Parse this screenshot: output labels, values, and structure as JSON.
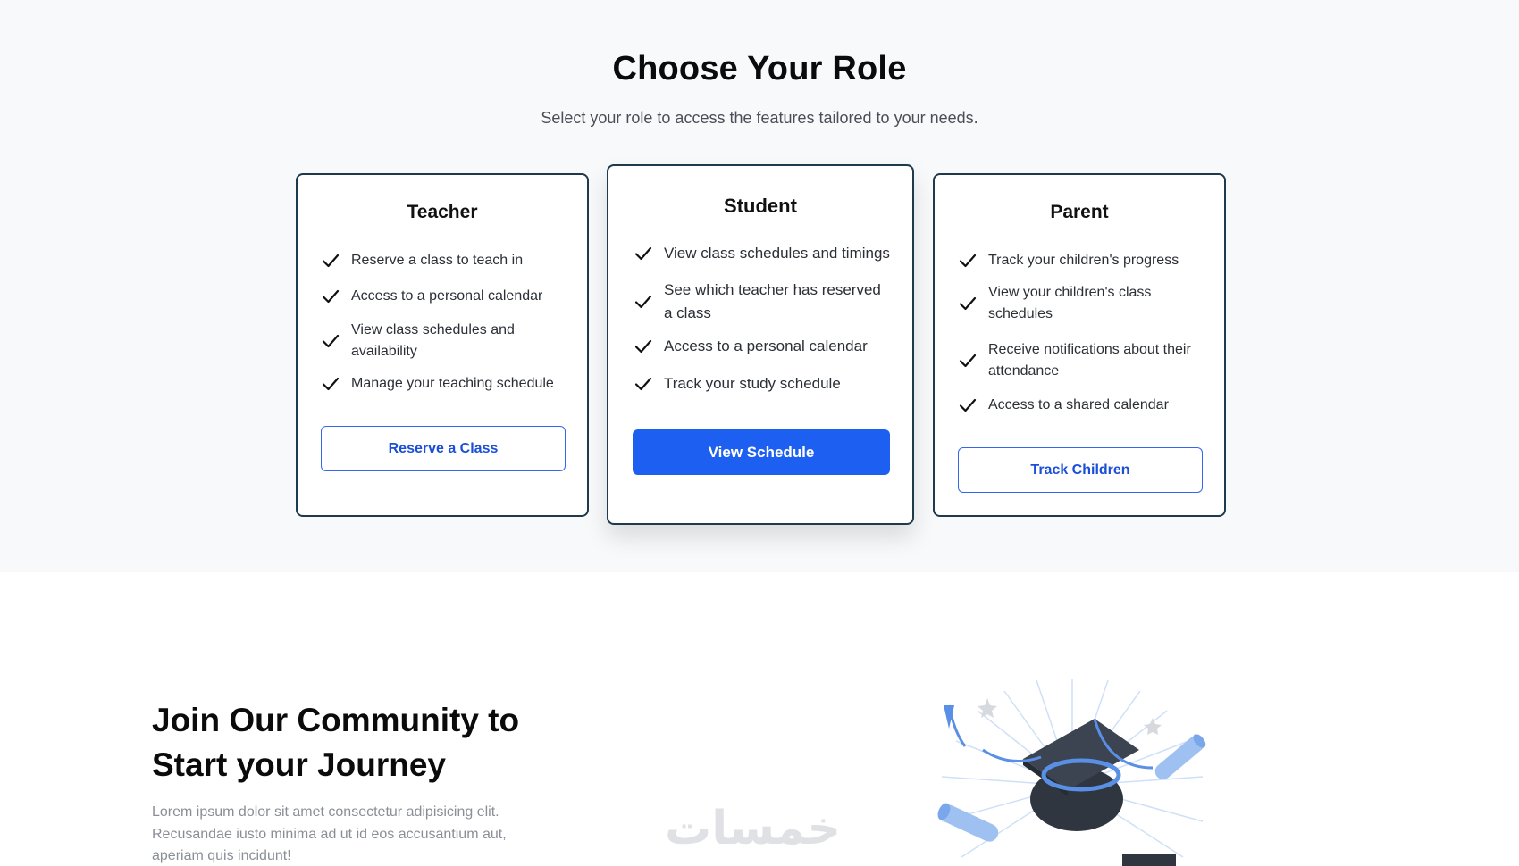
{
  "roles": {
    "title": "Choose Your Role",
    "subtitle": "Select your role to access the features tailored to your needs.",
    "cards": [
      {
        "title": "Teacher",
        "features": [
          "Reserve a class to teach in",
          "Access to a personal calendar",
          "View class schedules and availability",
          "Manage your teaching schedule"
        ],
        "button": "Reserve a Class"
      },
      {
        "title": "Student",
        "features": [
          "View class schedules and timings",
          "See which teacher has reserved a class",
          "Access to a personal calendar",
          "Track your study schedule"
        ],
        "button": "View Schedule"
      },
      {
        "title": "Parent",
        "features": [
          "Track your children's progress",
          "View your children's class schedules",
          "Receive notifications about their attendance",
          "Access to a shared calendar"
        ],
        "button": "Track Children"
      }
    ]
  },
  "join": {
    "title_line1": "Join Our Community to",
    "title_line2": "Start your Journey",
    "text": "Lorem ipsum dolor sit amet consectetur adipisicing elit. Recusandae iusto minima ad ut id eos accusantium aut, aperiam quis incidunt!"
  },
  "watermark": "خمسات",
  "icons": {
    "feature": "check-icon",
    "illustration": "graduation-cap-illustration"
  },
  "colors": {
    "primary": "#1d5ff0",
    "card_border": "#1e3a4c",
    "section_bg": "#f8f9fb"
  }
}
